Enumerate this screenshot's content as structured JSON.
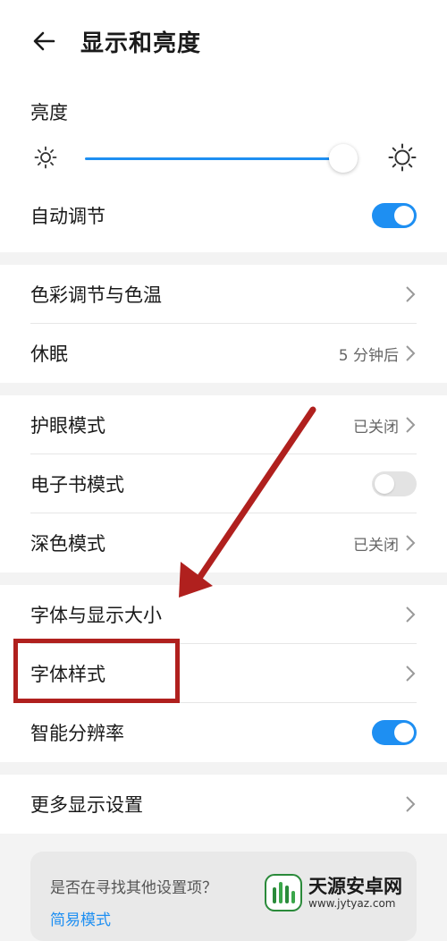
{
  "header": {
    "title": "显示和亮度"
  },
  "brightness": {
    "label": "亮度",
    "level_fraction": 0.95
  },
  "auto_adjust": {
    "label": "自动调节",
    "on": true
  },
  "group2": [
    {
      "label": "色彩调节与色温",
      "value": ""
    },
    {
      "label": "休眠",
      "value": "5 分钟后"
    }
  ],
  "group3": {
    "eye_care": {
      "label": "护眼模式",
      "value": "已关闭"
    },
    "ebook": {
      "label": "电子书模式",
      "on": false
    },
    "dark": {
      "label": "深色模式",
      "value": "已关闭"
    }
  },
  "group4": {
    "font_size": {
      "label": "字体与显示大小"
    },
    "font_style": {
      "label": "字体样式"
    },
    "smart_res": {
      "label": "智能分辨率",
      "on": true
    }
  },
  "group5": {
    "more": {
      "label": "更多显示设置"
    }
  },
  "footer": {
    "question": "是否在寻找其他设置项？",
    "link": "简易模式"
  },
  "watermark": {
    "title": "天源安卓网",
    "url": "www.jytyaz.com"
  },
  "colors": {
    "accent": "#1e8ff2",
    "annotation": "#b0201e"
  }
}
